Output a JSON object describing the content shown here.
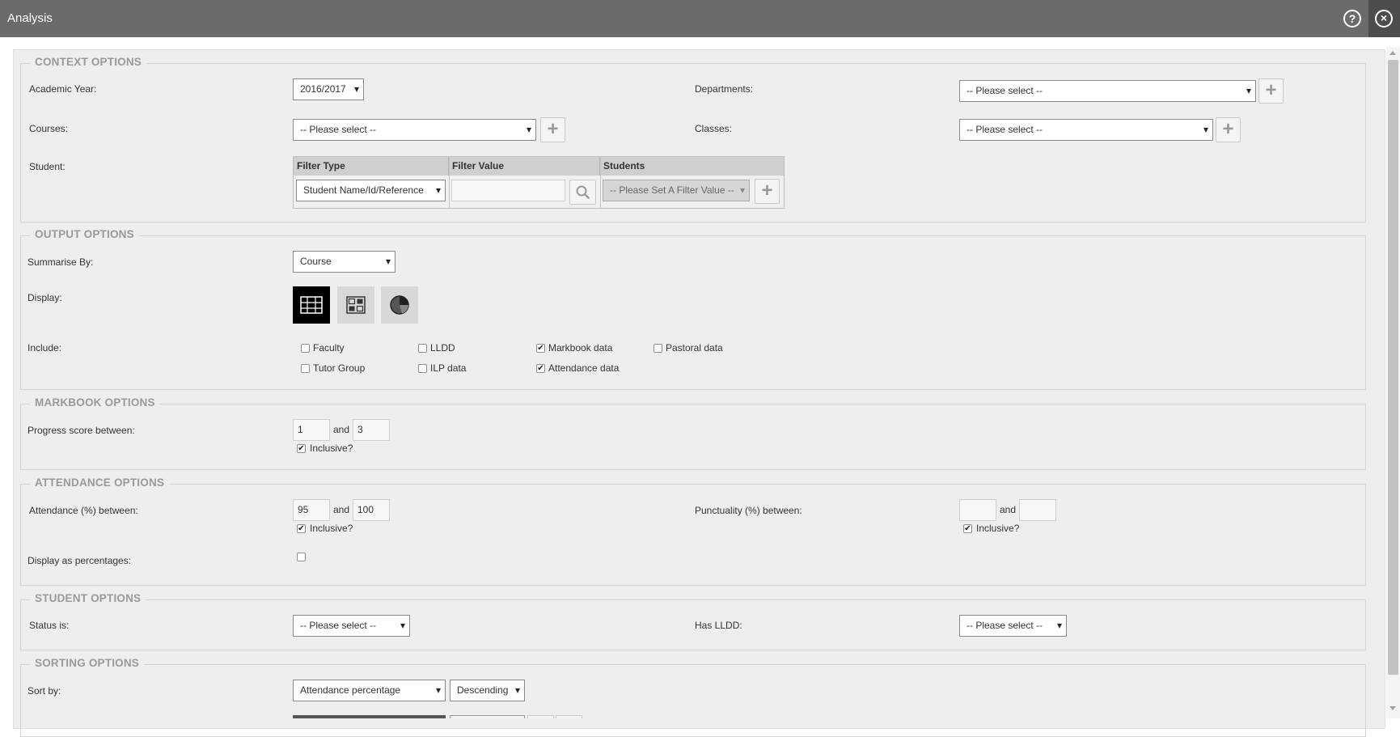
{
  "window": {
    "title": "Analysis",
    "help_label": "?",
    "close_label": "×"
  },
  "context": {
    "legend": "CONTEXT OPTIONS",
    "academic_year_label": "Academic Year:",
    "academic_year_value": "2016/2017",
    "departments_label": "Departments:",
    "departments_value": "-- Please select --",
    "courses_label": "Courses:",
    "courses_value": "-- Please select --",
    "classes_label": "Classes:",
    "classes_value": "-- Please select --",
    "student_label": "Student:",
    "student_table": {
      "col_filter_type": "Filter Type",
      "col_filter_value": "Filter Value",
      "col_students": "Students",
      "filter_type_value": "Student Name/Id/Reference",
      "filter_value": "",
      "students_value": "-- Please Set A Filter Value --"
    },
    "plus_label": "+"
  },
  "output": {
    "legend": "OUTPUT OPTIONS",
    "summarise_label": "Summarise By:",
    "summarise_value": "Course",
    "display_label": "Display:",
    "display_modes": [
      "table-grid-icon",
      "tile-grid-icon",
      "pie-chart-icon"
    ],
    "display_selected": "table-grid-icon",
    "include_label": "Include:",
    "include": [
      {
        "label": "Faculty",
        "checked": false
      },
      {
        "label": "LLDD",
        "checked": false
      },
      {
        "label": "Markbook data",
        "checked": true
      },
      {
        "label": "Pastoral data",
        "checked": false
      },
      {
        "label": "Tutor Group",
        "checked": false
      },
      {
        "label": "ILP data",
        "checked": false
      },
      {
        "label": "Attendance data",
        "checked": true
      }
    ]
  },
  "markbook": {
    "legend": "MARKBOOK OPTIONS",
    "progress_label": "Progress score between:",
    "progress_min": "1",
    "and_label": "and",
    "progress_max": "3",
    "inclusive_label": "Inclusive?",
    "inclusive_checked": true
  },
  "attendance": {
    "legend": "ATTENDANCE OPTIONS",
    "attendance_label": "Attendance (%) between:",
    "attendance_min": "95",
    "and_label": "and",
    "attendance_max": "100",
    "inclusive_label": "Inclusive?",
    "attendance_inclusive": true,
    "punctuality_label": "Punctuality (%) between:",
    "punctuality_min": "",
    "punctuality_max": "",
    "punctuality_inclusive": true,
    "display_percent_label": "Display as percentages:",
    "display_percent_checked": false
  },
  "student_opts": {
    "legend": "STUDENT OPTIONS",
    "status_label": "Status is:",
    "status_value": "-- Please select --",
    "lldd_label": "Has LLDD:",
    "lldd_value": "-- Please select --"
  },
  "sorting": {
    "legend": "SORTING OPTIONS",
    "sort_label": "Sort by:",
    "sort_field": "Attendance percentage",
    "sort_order": "Descending"
  },
  "colors": {
    "titlebar": "#6b6b6b",
    "close_bg": "#4d4d4d",
    "panel_bg": "#eeeeee",
    "legend_text": "#999999",
    "selected_display": "#000000"
  }
}
